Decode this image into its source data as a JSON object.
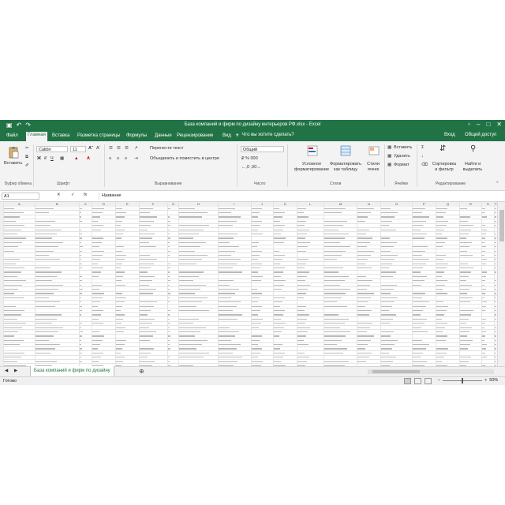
{
  "window": {
    "title": "База компаний и фирм по дизайну интерьеров РФ.xlsx - Excel"
  },
  "tabs": [
    "Файл",
    "Главная",
    "Вставка",
    "Разметка страницы",
    "Формулы",
    "Данные",
    "Рецензирование",
    "Вид"
  ],
  "active_tab": 1,
  "tell_me": "Что вы хотите сделать?",
  "account": {
    "sign_in": "Вход",
    "share": "Общий доступ"
  },
  "ribbon": {
    "clipboard": {
      "name": "Буфер обмена",
      "paste": "Вставить"
    },
    "font": {
      "name": "Шрифт",
      "font_name": "Calibri",
      "font_size": "11",
      "bold": "Ж",
      "italic": "К",
      "underline": "Ч"
    },
    "alignment": {
      "name": "Выравнивание",
      "wrap": "Перенести текст",
      "merge": "Объединить и поместить в центре"
    },
    "number": {
      "name": "Число",
      "format": "Общий"
    },
    "styles": {
      "name": "Стили",
      "conditional": "Условное форматирование",
      "format_table": "Форматировать как таблицу",
      "cell_styles": "Стили ячеек"
    },
    "cells": {
      "name": "Ячейки",
      "insert": "Вставить",
      "delete": "Удалить",
      "format": "Формат"
    },
    "editing": {
      "name": "Редактирование",
      "sort": "Сортировка и фильтр",
      "find": "Найти и выделить"
    }
  },
  "name_box": "A1",
  "formula": "Название",
  "columns": [
    "A",
    "B",
    "C",
    "D",
    "E",
    "F",
    "G",
    "H",
    "I",
    "J",
    "K",
    "L",
    "M",
    "N",
    "O",
    "P",
    "Q",
    "R",
    "S",
    "T"
  ],
  "sheet_tab": "База компаний и фирм по дизайну",
  "status": {
    "ready": "Готово",
    "zoom": "50%"
  }
}
